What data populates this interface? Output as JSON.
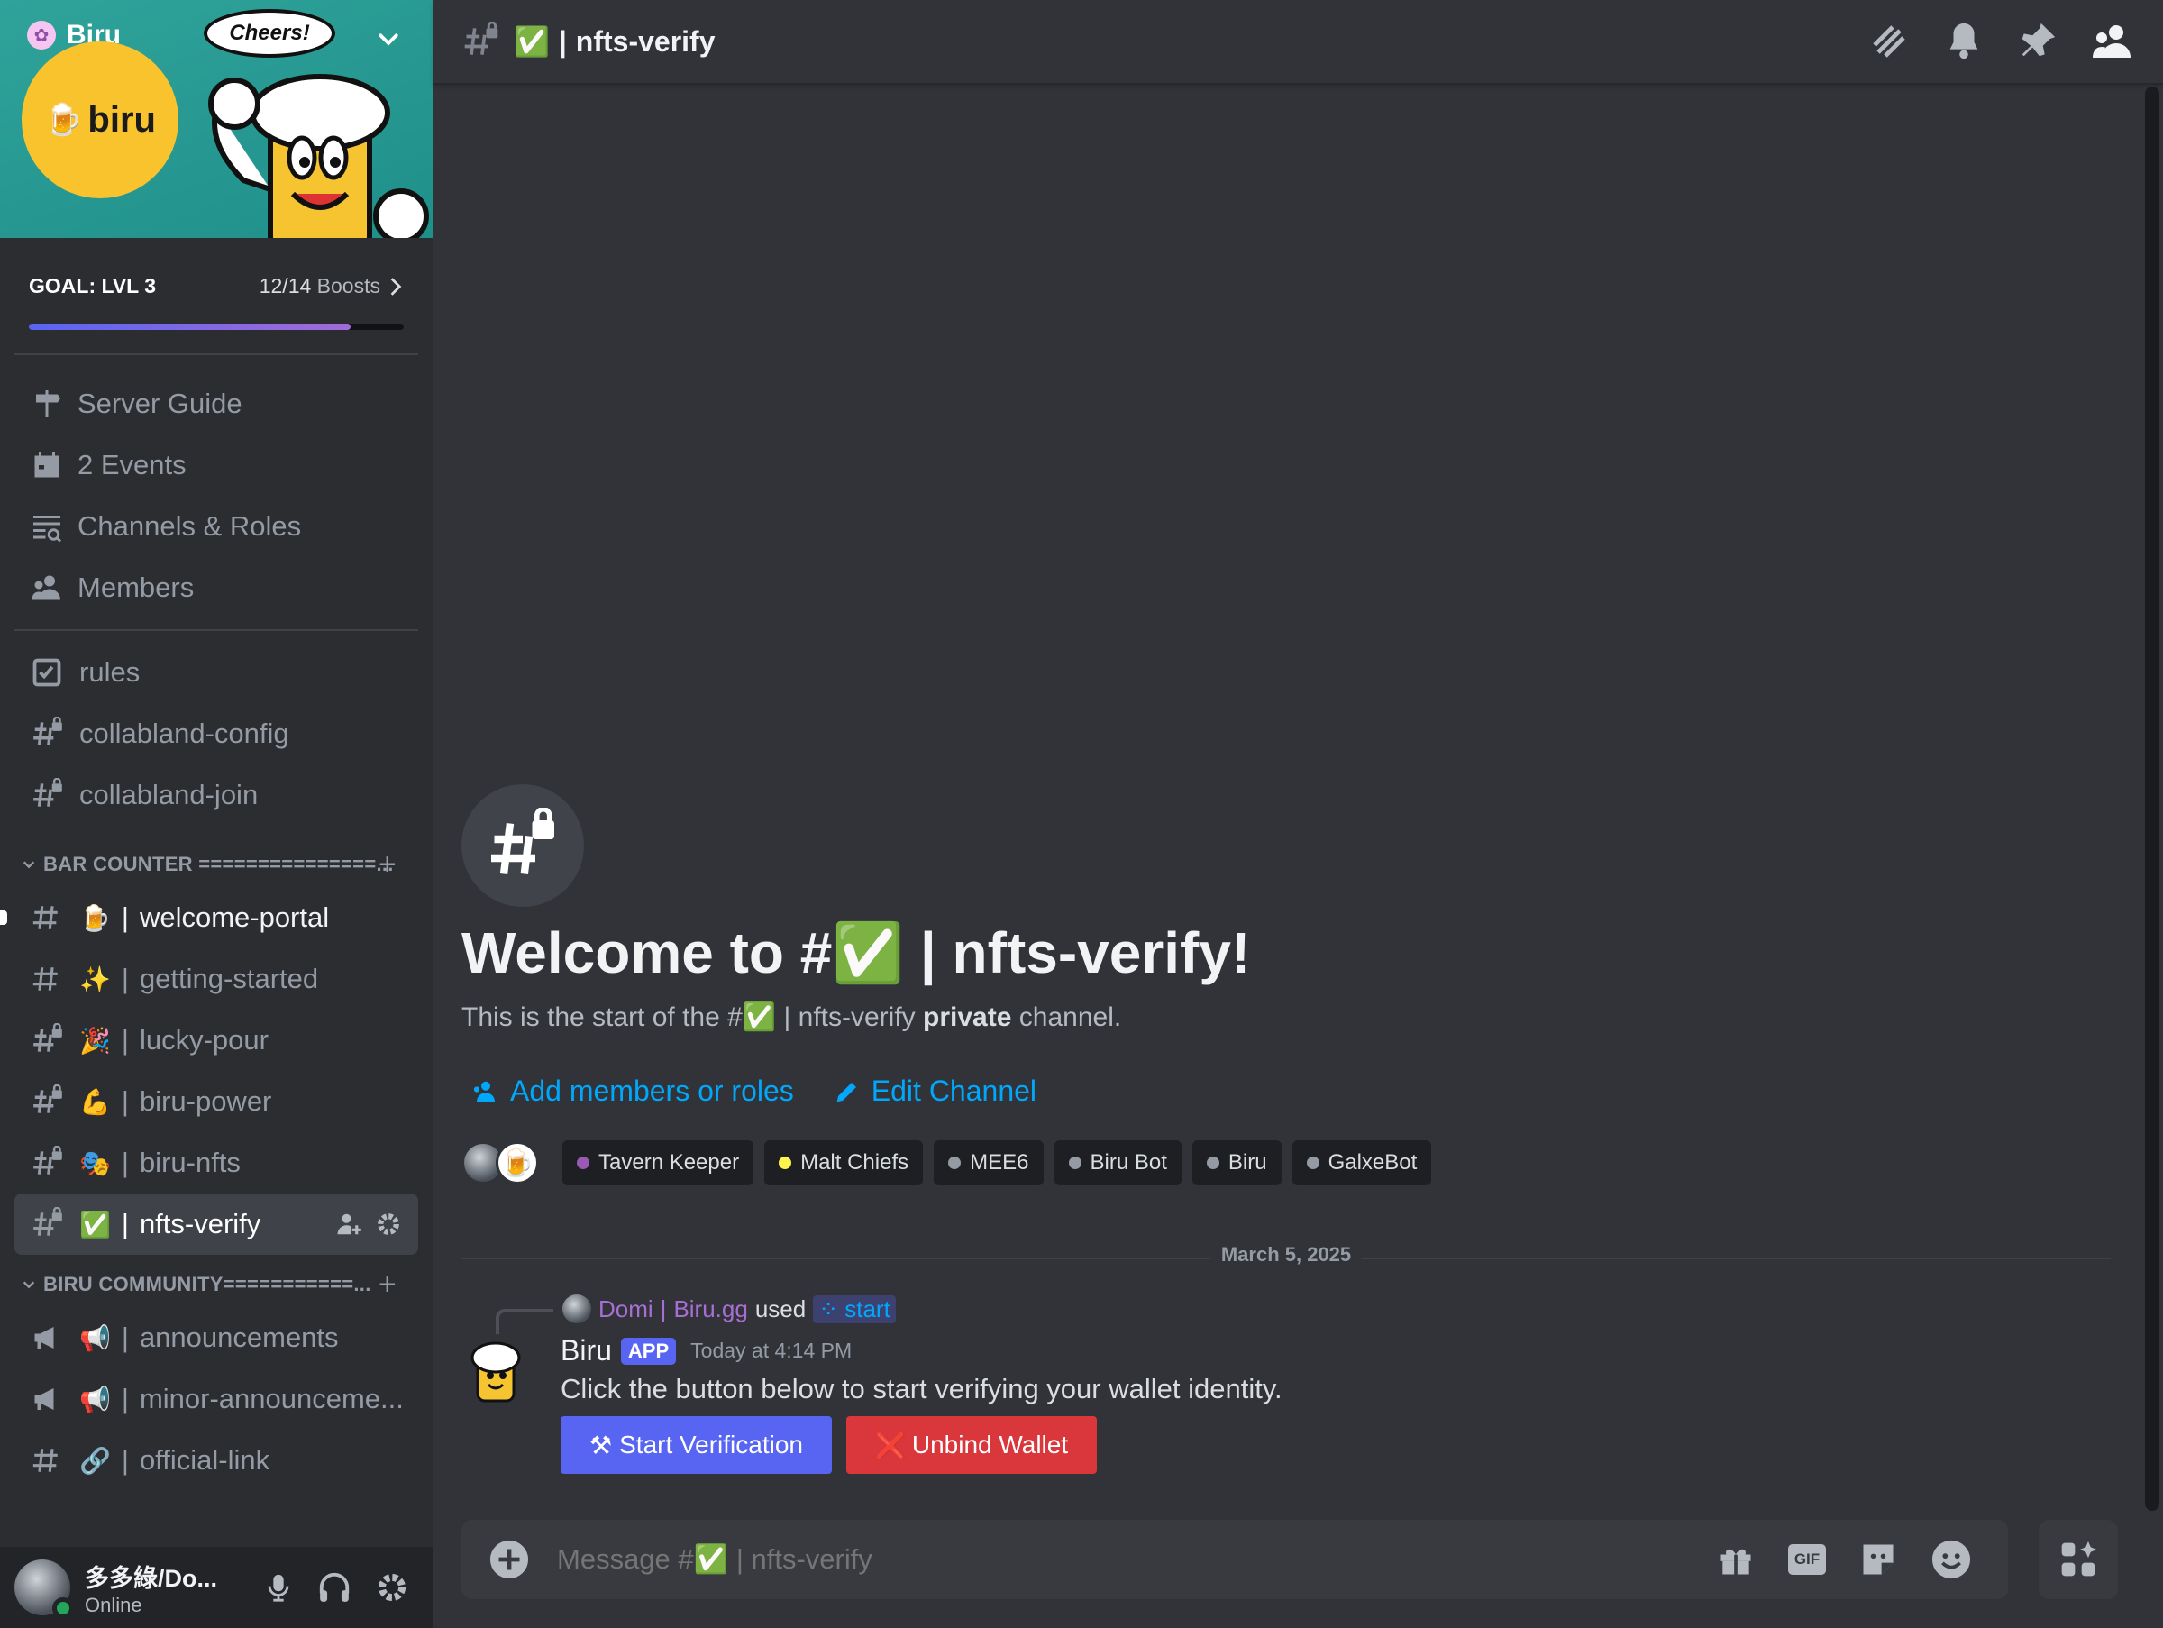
{
  "server": {
    "name": "Biru",
    "banner_logo_text": "biru",
    "banner_bubble_text": "Cheers!"
  },
  "goal": {
    "label": "GOAL: LVL 3",
    "boosts": "12/14",
    "boosts_suffix": "Boosts",
    "progress_fraction": 0.857
  },
  "nav": {
    "items": [
      {
        "label": "Server Guide",
        "icon": "signpost-icon"
      },
      {
        "label": "2 Events",
        "icon": "calendar-icon"
      },
      {
        "label": "Channels & Roles",
        "icon": "channels-search-icon"
      },
      {
        "label": "Members",
        "icon": "members-icon"
      }
    ]
  },
  "channels_top": [
    {
      "label": "rules",
      "icon": "rules-icon"
    },
    {
      "label": "collabland-config",
      "icon": "hash-lock-icon"
    },
    {
      "label": "collabland-join",
      "icon": "hash-lock-icon"
    }
  ],
  "categories": [
    {
      "label": "BAR COUNTER ===============...",
      "channels": [
        {
          "emoji": "🍺",
          "label": "welcome-portal",
          "locked": false,
          "state": "unread"
        },
        {
          "emoji": "✨",
          "label": "getting-started",
          "locked": false,
          "state": "normal"
        },
        {
          "emoji": "🎉",
          "label": "lucky-pour",
          "locked": true,
          "state": "normal"
        },
        {
          "emoji": "💪",
          "label": "biru-power",
          "locked": true,
          "state": "normal"
        },
        {
          "emoji": "🎭",
          "label": "biru-nfts",
          "locked": true,
          "state": "normal"
        },
        {
          "emoji": "✅",
          "label": "nfts-verify",
          "locked": true,
          "state": "active"
        }
      ]
    },
    {
      "label": "BIRU COMMUNITY===========...",
      "channels": [
        {
          "emoji": "📢",
          "label": "announcements",
          "type": "announce"
        },
        {
          "emoji": "📢",
          "label": "minor-announceme...",
          "type": "announce"
        },
        {
          "emoji": "🔗",
          "label": "official-link",
          "type": "text"
        }
      ]
    }
  ],
  "sep": "|",
  "user": {
    "name": "多多綠/Do...",
    "status": "Online"
  },
  "channel": {
    "emoji": "✅",
    "name": "nfts-verify",
    "topbar_icons": [
      "threads-icon",
      "bell-icon",
      "pin-icon",
      "member-list-icon"
    ]
  },
  "welcome": {
    "title_prefix": "Welcome to #",
    "title_suffix": "nfts-verify!",
    "desc_prefix": "This is the start of the #",
    "desc_channel": "nfts-verify",
    "desc_private": "private",
    "desc_suffix": "channel.",
    "add_members": "Add members or roles",
    "edit_channel": "Edit Channel"
  },
  "roles": [
    {
      "name": "Tavern Keeper",
      "color": "#9b59b6"
    },
    {
      "name": "Malt Chiefs",
      "color": "#fff34d"
    },
    {
      "name": "MEE6",
      "color": "#949ba4"
    },
    {
      "name": "Biru Bot",
      "color": "#949ba4"
    },
    {
      "name": "Biru",
      "color": "#949ba4"
    },
    {
      "name": "GalxeBot",
      "color": "#949ba4"
    }
  ],
  "date_divider": "March 5, 2025",
  "message": {
    "reply_user": "Domi",
    "reply_user_suffix": "Biru.gg",
    "reply_used": "used",
    "reply_command": "start",
    "author": "Biru",
    "badge": "APP",
    "time": "Today at 4:14 PM",
    "text": "Click the button below to start verifying your wallet identity.",
    "button_primary": "Start Verification",
    "button_primary_emoji": "⚒",
    "button_danger": "Unbind Wallet",
    "button_danger_emoji": "❌"
  },
  "composer": {
    "placeholder": "Message #✅ | nfts-verify",
    "gif_label": "GIF"
  },
  "colors": {
    "accent": "#5865f2",
    "link": "#00a8fc",
    "danger": "#da373c",
    "online": "#23a55a",
    "sidebar_bg": "#2b2d31",
    "main_bg": "#313338"
  }
}
